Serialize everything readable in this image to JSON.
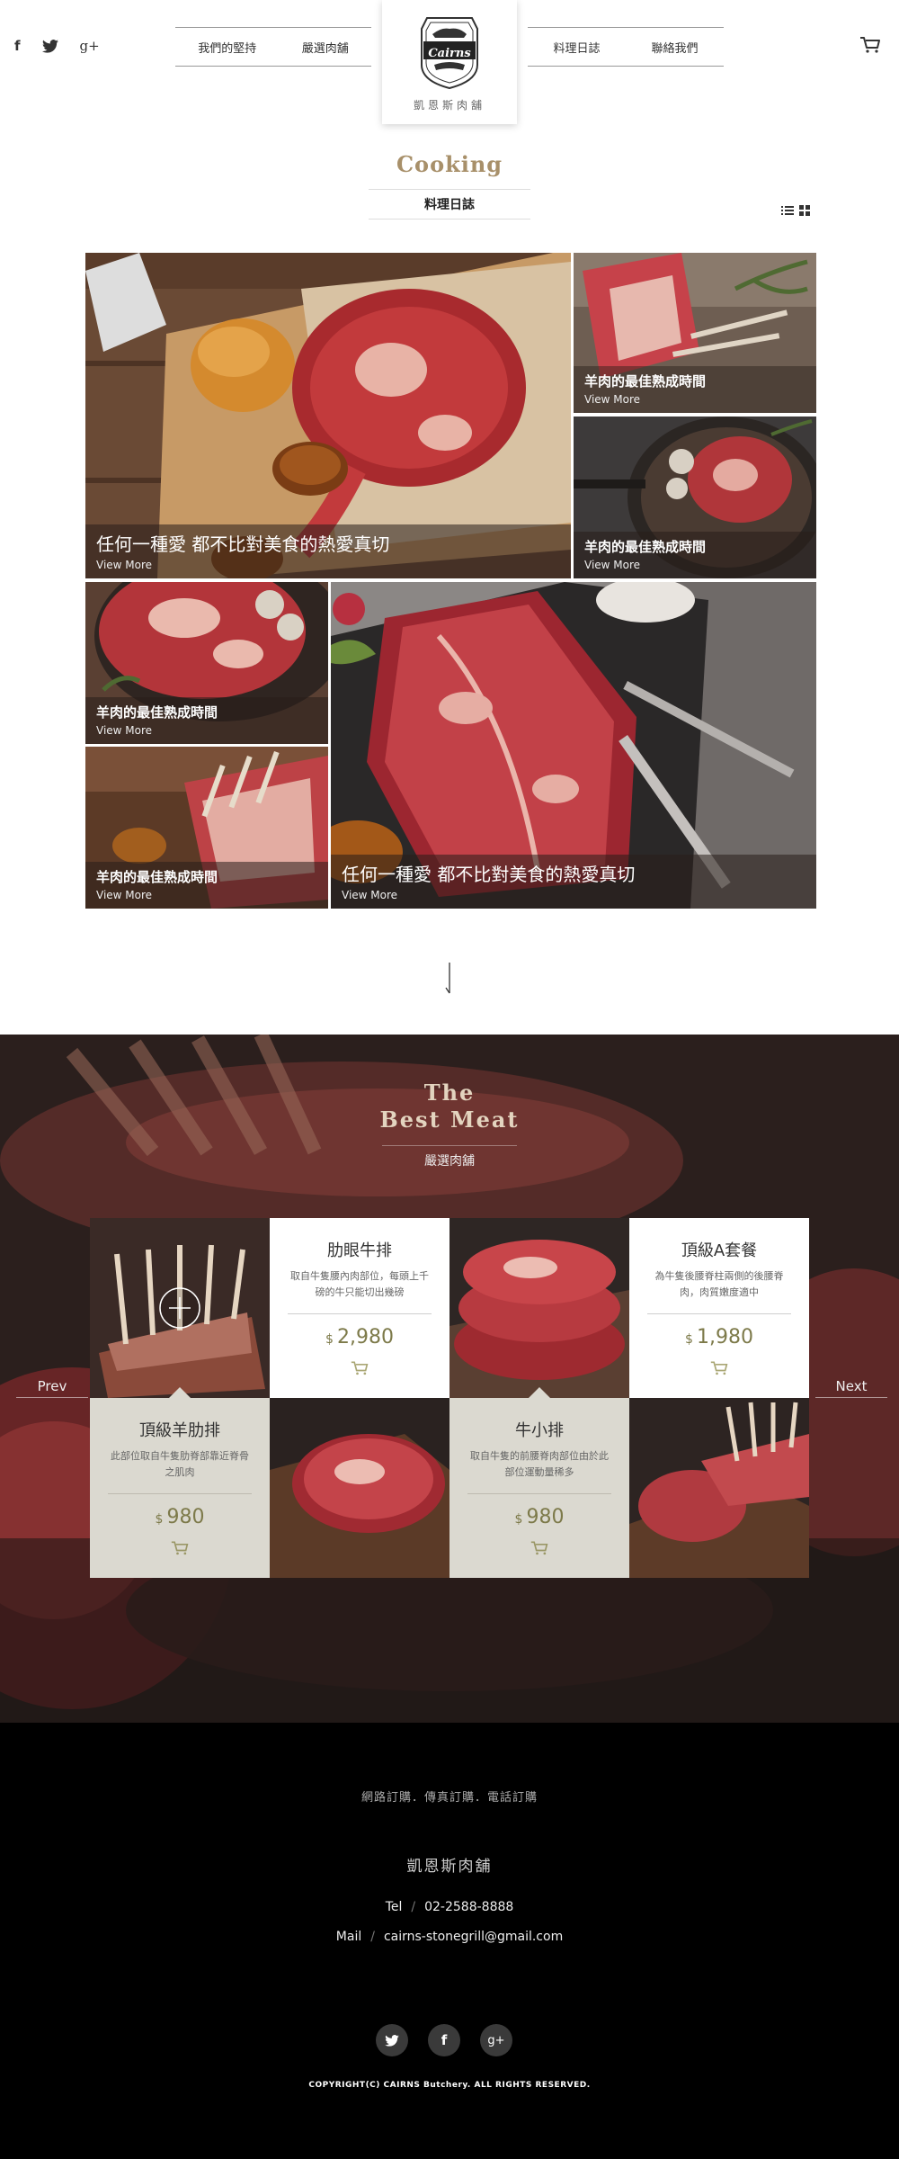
{
  "header": {
    "social": {
      "facebook": "f",
      "twitter": "t",
      "googleplus": "g+"
    },
    "nav_left": [
      "我們的堅持",
      "嚴選肉舖"
    ],
    "nav_right": [
      "料理日誌",
      "聯絡我們"
    ],
    "logo_text": "Cairns",
    "logo_name": "凱恩斯肉舖"
  },
  "cooking": {
    "title": "Cooking",
    "subtitle": "料理日誌",
    "tiles": [
      {
        "title": "任何一種愛  都不比對美食的熱愛真切",
        "more": "View More"
      },
      {
        "title": "羊肉的最佳熟成時間",
        "more": "View More"
      },
      {
        "title": "羊肉的最佳熟成時間",
        "more": "View More"
      },
      {
        "title": "羊肉的最佳熟成時間",
        "more": "View More"
      },
      {
        "title": "羊肉的最佳熟成時間",
        "more": "View More"
      },
      {
        "title": "任何一種愛  都不比對美食的熱愛真切",
        "more": "View More"
      }
    ]
  },
  "best_meat": {
    "title_line1": "The",
    "title_line2": "Best Meat",
    "subtitle": "嚴選肉舖",
    "prev": "Prev",
    "next": "Next",
    "currency": "$",
    "products": [
      {
        "name": "肋眼牛排",
        "desc": "取自牛隻腰內肉部位，每頭上千磅的牛只能切出幾磅",
        "price": "2,980"
      },
      {
        "name": "頂級A套餐",
        "desc": "為牛隻後腰脊柱兩側的後腰脊肉，肉質嫩度適中",
        "price": "1,980"
      },
      {
        "name": "頂級羊肋排",
        "desc": "此部位取自牛隻肋脊部靠近脊骨之肌肉",
        "price": "980"
      },
      {
        "name": "牛小排",
        "desc": "取自牛隻的前腰脊肉部位由於此部位運動量稀多",
        "price": "980"
      }
    ]
  },
  "footer": {
    "order": "網路訂購．傳真訂購．電話訂購",
    "name": "凱恩斯肉舖",
    "tel_label": "Tel",
    "tel": "02-2588-8888",
    "mail_label": "Mail",
    "mail": "cairns-stonegrill@gmail.com",
    "separator": "/",
    "copyright": "COPYRIGHT(C) CAIRNS Butchery. ALL RIGHTS RESERVED."
  },
  "colors": {
    "accent": "#a8906a",
    "price": "#7d7a4a",
    "card_beige": "#dbd9d0",
    "footer_bg": "#000000"
  }
}
